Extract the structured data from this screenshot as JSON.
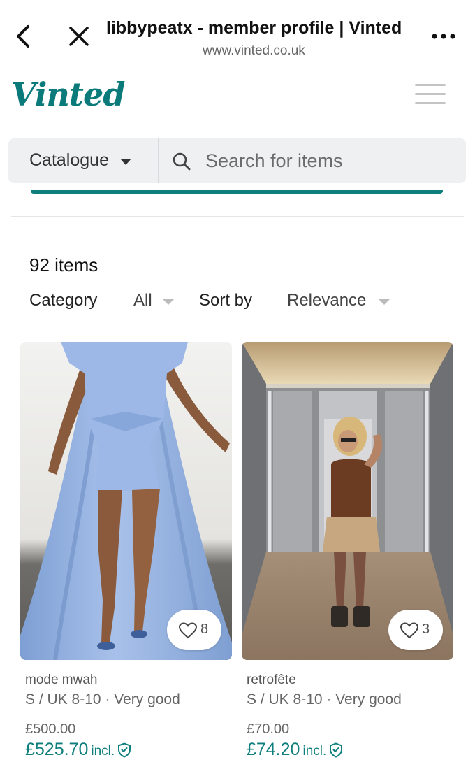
{
  "browser": {
    "title": "libbypeatx - member profile | Vinted",
    "url": "www.vinted.co.uk"
  },
  "header": {
    "logo": "Vinted"
  },
  "search": {
    "catalogue_label": "Catalogue",
    "placeholder": "Search for items"
  },
  "listing": {
    "count": "92 items",
    "category_label": "Category",
    "category_value": "All",
    "sort_label": "Sort by",
    "sort_value": "Relevance"
  },
  "items": [
    {
      "seller": "mode mwah",
      "details": "S / UK 8-10 · Very good",
      "price": "£500.00",
      "total": "£525.70",
      "incl": "incl.",
      "likes": "8"
    },
    {
      "seller": "retrofête",
      "details": "S / UK 8-10 · Very good",
      "price": "£70.00",
      "total": "£74.20",
      "incl": "incl.",
      "likes": "3"
    }
  ],
  "colors": {
    "brand": "#0b7a7a",
    "accent": "#0e7f7c"
  }
}
